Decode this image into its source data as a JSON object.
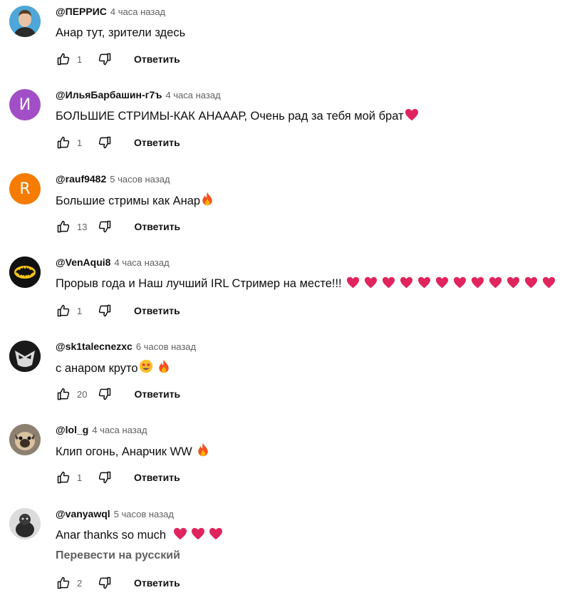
{
  "reply_label": "Ответить",
  "colors": {
    "heart": "#e0245e",
    "accent_text": "#0f0f0f",
    "secondary_text": "#606060"
  },
  "comments": [
    {
      "author": "@ПЕРРИС",
      "time": "4 часа назад",
      "text": "Анар тут, зрители здесь",
      "likes": "1",
      "avatar": {
        "type": "photo",
        "bg": "#4ea7d8",
        "desc": "young man portrait"
      }
    },
    {
      "author": "@ИльяБарбашин-г7ъ",
      "time": "4 часа назад",
      "text": "БОЛЬШИЕ СТРИМЫ-КАК АНАААР, Очень рад за тебя мой брат",
      "likes": "1",
      "avatar": {
        "type": "letter",
        "letter": "И",
        "bg": "#a24fc7"
      },
      "emoji": [
        "heart"
      ]
    },
    {
      "author": "@rauf9482",
      "time": "5 часов назад",
      "text": "Большие стримы как Анар",
      "likes": "13",
      "avatar": {
        "type": "letter",
        "letter": "R",
        "bg": "#f57c00"
      },
      "emoji": [
        "fire"
      ]
    },
    {
      "author": "@VenAqui8",
      "time": "4 часа назад",
      "text": "Прорыв года и Наш лучший IRL Стример на месте!!!",
      "likes": "1",
      "avatar": {
        "type": "batman",
        "bg": "#111111"
      },
      "emoji": [
        "heart",
        "heart",
        "heart",
        "heart",
        "heart",
        "heart",
        "heart",
        "heart",
        "heart",
        "heart",
        "heart",
        "heart"
      ]
    },
    {
      "author": "@sk1talecnezxc",
      "time": "6 часов назад",
      "text": "с анаром круто",
      "likes": "20",
      "avatar": {
        "type": "mask",
        "bg": "#1a1a1a"
      },
      "emoji": [
        "star-eyes",
        "fire"
      ]
    },
    {
      "author": "@lol_g",
      "time": "4 часа назад",
      "text": "Клип огонь, Анарчик WW",
      "likes": "1",
      "avatar": {
        "type": "pug",
        "bg": "#b9a58d"
      },
      "emoji": [
        "fire"
      ]
    },
    {
      "author": "@vanyawql",
      "time": "5 часов назад",
      "text": "Anar thanks so much",
      "likes": "2",
      "avatar": {
        "type": "dog",
        "bg": "#d8d8d8"
      },
      "emoji": [
        "heart",
        "heart",
        "heart"
      ],
      "translate": "Перевести на русский"
    }
  ]
}
